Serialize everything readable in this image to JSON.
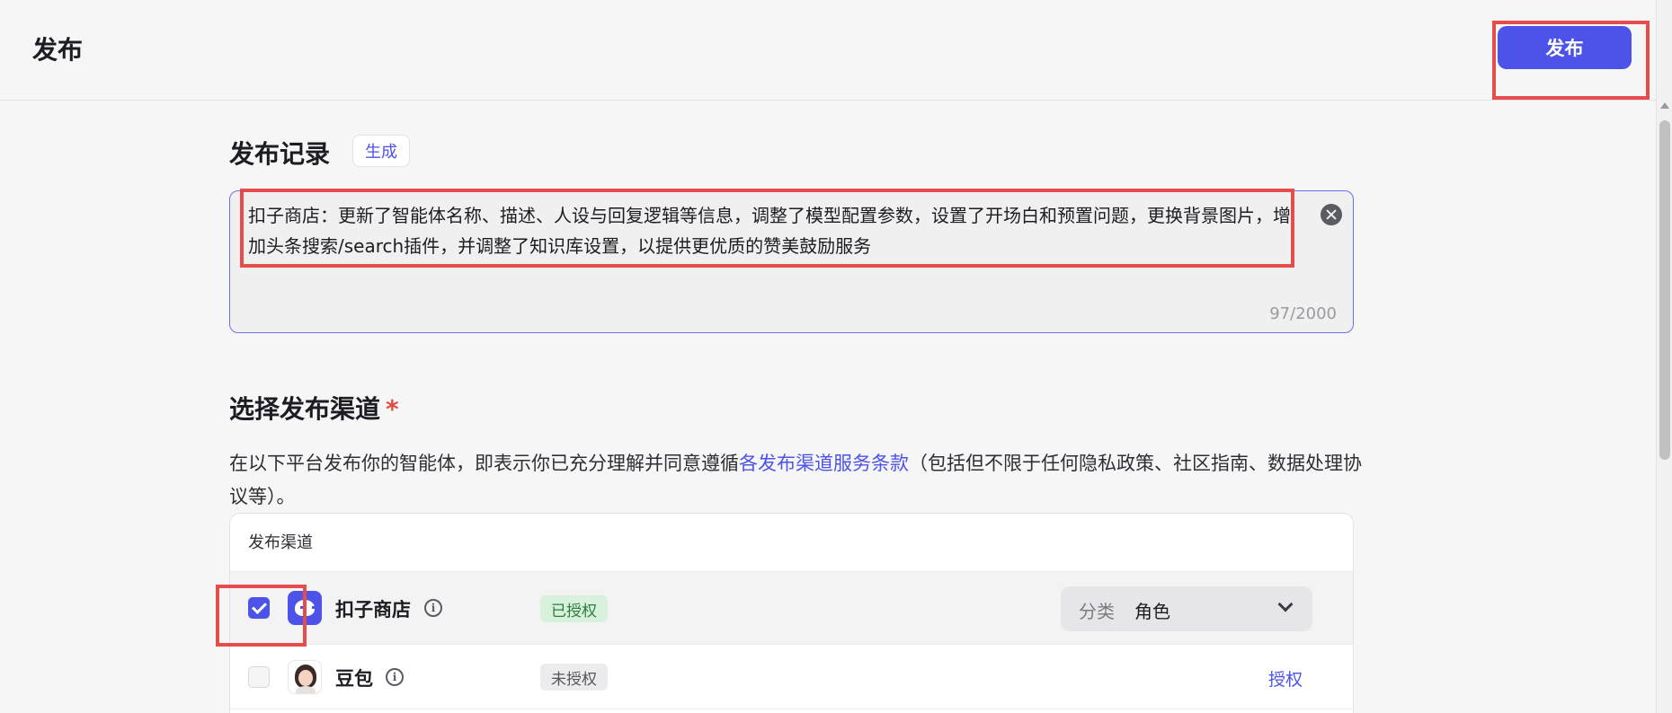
{
  "header": {
    "title": "发布",
    "publish_button": "发布"
  },
  "record": {
    "title": "发布记录",
    "generate_button": "生成",
    "text": "扣子商店：更新了智能体名称、描述、人设与回复逻辑等信息，调整了模型配置参数，设置了开场白和预置问题，更换背景图片，增加头条搜索/search插件，并调整了知识库设置，以提供更优质的赞美鼓励服务",
    "counter": "97/2000"
  },
  "channels": {
    "title": "选择发布渠道",
    "required_mark": "*",
    "terms_before": "在以下平台发布你的智能体，即表示你已充分理解并同意遵循",
    "terms_link": "各发布渠道服务条款",
    "terms_after": "（包括但不限于任何隐私政策、社区指南、数据处理协议等）。",
    "table_header": "发布渠道",
    "rows": [
      {
        "name": "扣子商店",
        "icon": "coze-store-icon",
        "checked": true,
        "status": "已授权",
        "category_label": "分类",
        "category_value": "角色"
      },
      {
        "name": "豆包",
        "icon": "doubao-avatar-icon",
        "checked": false,
        "status": "未授权",
        "action": "授权"
      }
    ]
  },
  "colors": {
    "accent": "#4d53e8",
    "highlight": "#e74c4c",
    "authorized_bg": "#d7f1dd",
    "required": "#e24a41"
  }
}
